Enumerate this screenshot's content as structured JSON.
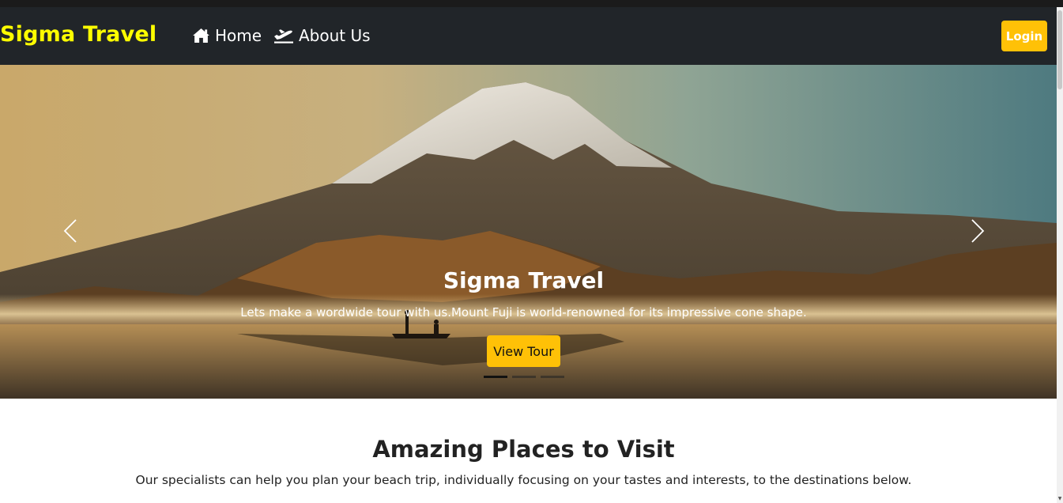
{
  "navbar": {
    "brand": "Sigma Travel",
    "links": [
      {
        "label": "Home",
        "icon": "home-icon"
      },
      {
        "label": "About Us",
        "icon": "plane-departure-icon"
      }
    ],
    "login_label": "Login"
  },
  "carousel": {
    "title": "Sigma Travel",
    "text": "Lets make a wordwide tour with us.Mount Fuji is world-renowned for its impressive cone shape.",
    "button_label": "View Tour",
    "slide_count": 3,
    "active_slide": 1,
    "prev_icon": "chevron-left-icon",
    "next_icon": "chevron-right-icon"
  },
  "section": {
    "title": "Amazing Places to Visit",
    "text": "Our specialists can help you plan your beach trip, individually focusing on your tastes and interests, to the destinations below."
  },
  "colors": {
    "navbar_bg": "#212529",
    "brand": "#ffff00",
    "accent": "#ffc107",
    "text_dark": "#222222"
  }
}
